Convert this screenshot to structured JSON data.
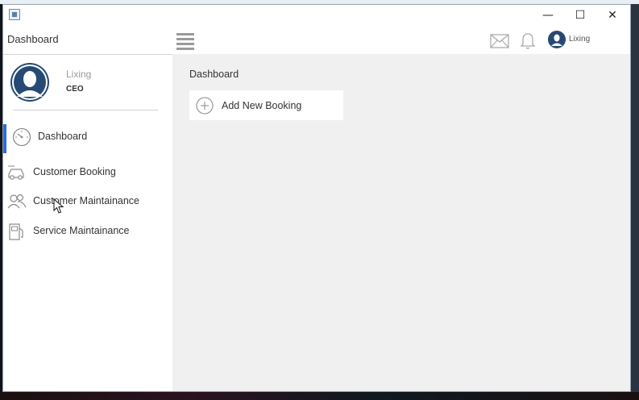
{
  "window": {
    "controls": {
      "minimize": "—",
      "maximize": "☐",
      "close": "✕"
    }
  },
  "sidebar": {
    "title": "Dashboard",
    "profile": {
      "name": "Lixing",
      "role": "CEO"
    },
    "items": [
      {
        "label": "Dashboard",
        "icon": "speedometer-icon",
        "active": true
      },
      {
        "label": "Customer Booking",
        "icon": "car-icon",
        "active": false
      },
      {
        "label": "Customer Maintainance",
        "icon": "users-icon",
        "active": false
      },
      {
        "label": "Service Maintainance",
        "icon": "fuel-pump-icon",
        "active": false
      }
    ],
    "active_color": "#2a6ae8"
  },
  "header": {
    "menu_icon": "hamburger-icon",
    "mail_icon": "mail-icon",
    "notification_icon": "bell-icon",
    "user_name": "Lixing"
  },
  "main": {
    "title": "Dashboard",
    "add_booking_label": "Add New Booking",
    "add_icon": "plus-circle-icon"
  }
}
